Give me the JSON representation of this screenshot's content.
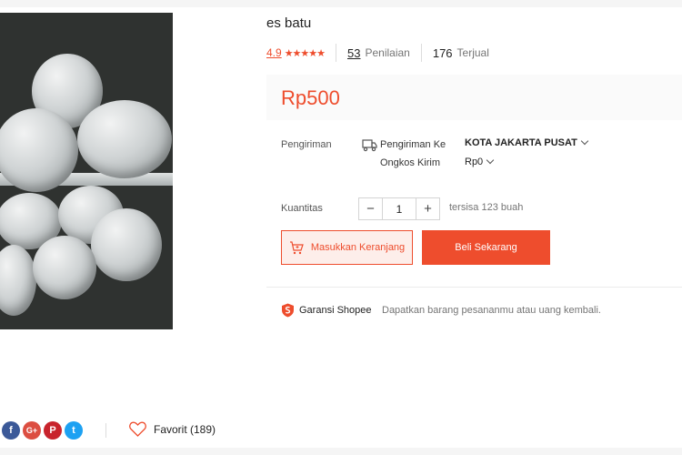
{
  "product": {
    "title": "es batu",
    "rating": "4.9",
    "stars": "★★★★★",
    "reviews_count": "53",
    "reviews_label": "Penilaian",
    "sold_count": "176",
    "sold_label": "Terjual",
    "price": "Rp500"
  },
  "shipping": {
    "label": "Pengiriman",
    "to_label": "Pengiriman Ke",
    "destination": "KOTA JAKARTA PUSAT",
    "fee_label": "Ongkos Kirim",
    "fee": "Rp0"
  },
  "quantity": {
    "label": "Kuantitas",
    "decrement": "−",
    "value": "1",
    "increment": "+",
    "stock": "tersisa 123 buah"
  },
  "actions": {
    "add_to_cart": "Masukkan Keranjang",
    "buy_now": "Beli Sekarang"
  },
  "guarantee": {
    "title": "Garansi Shopee",
    "description": "Dapatkan barang pesananmu atau uang kembali."
  },
  "share": {
    "facebook": "f",
    "google_plus": "G+",
    "pinterest": "P",
    "twitter": "t"
  },
  "favorite": {
    "label": "Favorit (189)"
  },
  "colors": {
    "accent": "#ee4d2d",
    "facebook": "#3b5998",
    "google_plus": "#dc4e41",
    "pinterest": "#c8232c",
    "twitter": "#1da1f2"
  }
}
